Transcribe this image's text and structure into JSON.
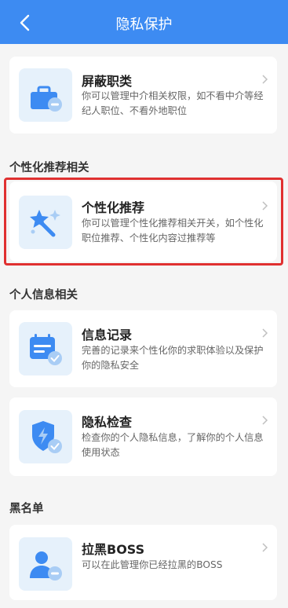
{
  "header": {
    "title": "隐私保护"
  },
  "cards": {
    "block_jobs": {
      "title": "屏蔽职类",
      "desc": "你可以管理中介相关权限，如不看中介等经纪人职位、不看外地职位"
    },
    "personalized": {
      "title": "个性化推荐",
      "desc": "你可以管理个性化推荐相关开关，如个性化职位推荐、个性化内容过推荐等"
    },
    "info_record": {
      "title": "信息记录",
      "desc": "完善的记录来个性化你的求职体验以及保护你的隐私安全"
    },
    "privacy_check": {
      "title": "隐私检查",
      "desc": "检查你的个人隐私信息，了解你的个人信息使用状态"
    },
    "block_boss": {
      "title": "拉黑BOSS",
      "desc": "可以在此管理你已经拉黑的BOSS"
    }
  },
  "sections": {
    "personalized": "个性化推荐相关",
    "personal_info": "个人信息相关",
    "blacklist": "黑名单"
  },
  "colors": {
    "accent": "#3d8bf2",
    "highlight": "#e03030",
    "icon_bg": "#e6f1fb"
  }
}
